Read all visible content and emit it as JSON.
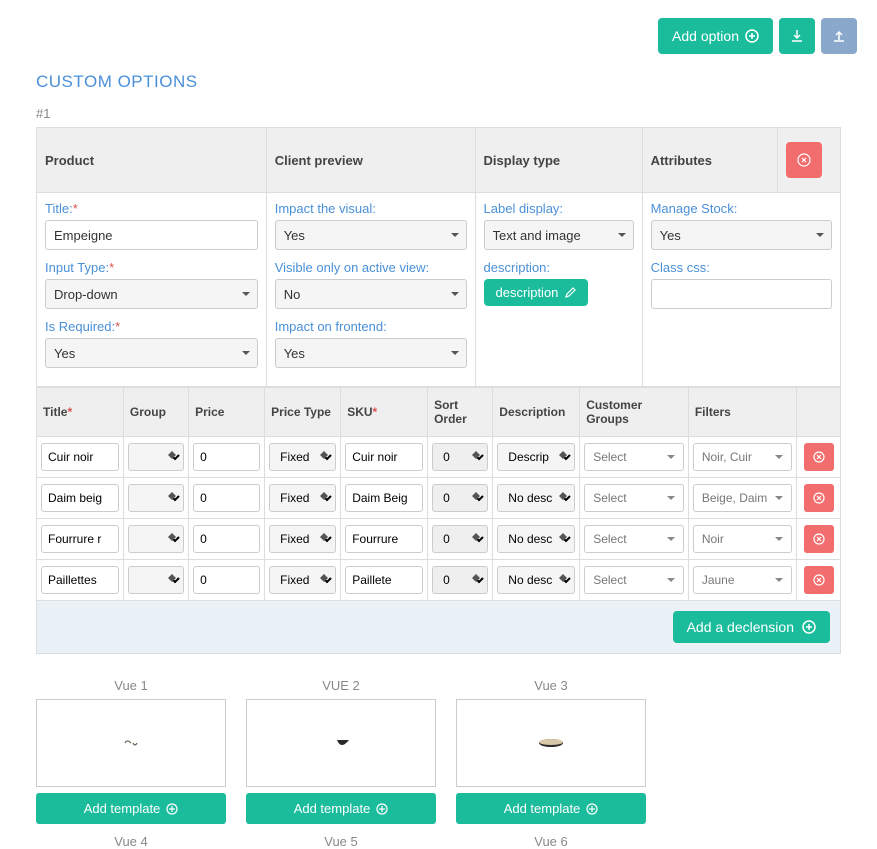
{
  "topbar": {
    "add_option": "Add option"
  },
  "heading": "CUSTOM OPTIONS",
  "section_tag": "#1",
  "config_headers": {
    "product": "Product",
    "client_preview": "Client preview",
    "display_type": "Display type",
    "attributes": "Attributes"
  },
  "product_col": {
    "title_label": "Title:",
    "title_value": "Empeigne",
    "input_type_label": "Input Type:",
    "input_type_value": "Drop-down",
    "required_label": "Is Required:",
    "required_value": "Yes"
  },
  "client_col": {
    "impact_visual_label": "Impact the visual:",
    "impact_visual_value": "Yes",
    "visible_active_label": "Visible only on active view:",
    "visible_active_value": "No",
    "impact_frontend_label": "Impact on frontend:",
    "impact_frontend_value": "Yes"
  },
  "display_col": {
    "label_display_label": "Label display:",
    "label_display_value": "Text and image",
    "description_label": "description:",
    "description_btn": "description"
  },
  "attr_col": {
    "manage_stock_label": "Manage Stock:",
    "manage_stock_value": "Yes",
    "class_css_label": "Class css:",
    "class_css_value": ""
  },
  "rows_headers": {
    "title": "Title",
    "group": "Group",
    "price": "Price",
    "price_type": "Price Type",
    "sku": "SKU",
    "sort_order": "Sort Order",
    "description": "Description",
    "customer_groups": "Customer Groups",
    "filters": "Filters"
  },
  "rows": [
    {
      "title": "Cuir noir",
      "group": "",
      "price": "0",
      "price_type": "Fixed",
      "sku": "Cuir noir",
      "sort": "0",
      "desc": "Descrip",
      "cg": "Select",
      "filter": "Noir, Cuir"
    },
    {
      "title": "Daim beig",
      "group": "",
      "price": "0",
      "price_type": "Fixed",
      "sku": "Daim Beig",
      "sort": "0",
      "desc": "No desc",
      "cg": "Select",
      "filter": "Beige, Daim"
    },
    {
      "title": "Fourrure r",
      "group": "",
      "price": "0",
      "price_type": "Fixed",
      "sku": "Fourrure",
      "sort": "0",
      "desc": "No desc",
      "cg": "Select",
      "filter": "Noir"
    },
    {
      "title": "Paillettes",
      "group": "",
      "price": "0",
      "price_type": "Fixed",
      "sku": "Paillete",
      "sort": "0",
      "desc": "No desc",
      "cg": "Select",
      "filter": "Jaune"
    }
  ],
  "add_declension": "Add a declension",
  "views": [
    {
      "title": "Vue 1",
      "add": "Add template"
    },
    {
      "title": "VUE 2",
      "add": "Add template"
    },
    {
      "title": "Vue 3",
      "add": "Add template"
    }
  ],
  "views2": [
    {
      "title": "Vue 4"
    },
    {
      "title": "Vue 5"
    },
    {
      "title": "Vue 6"
    }
  ]
}
